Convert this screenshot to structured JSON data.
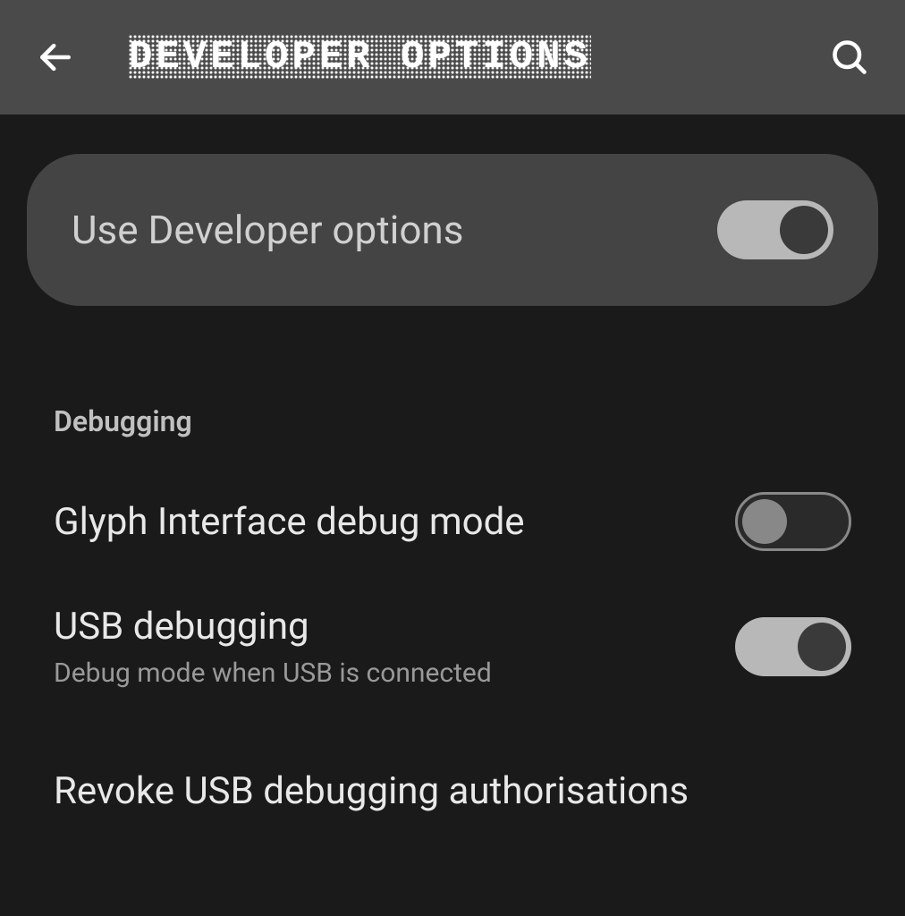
{
  "header": {
    "title": "DEVELOPER OPTIONS"
  },
  "main_toggle": {
    "label": "Use Developer options",
    "enabled": true
  },
  "section": {
    "title": "Debugging"
  },
  "settings": {
    "glyph_interface": {
      "title": "Glyph Interface debug mode",
      "enabled": false
    },
    "usb_debugging": {
      "title": "USB debugging",
      "subtitle": "Debug mode when USB is connected",
      "enabled": true
    },
    "revoke_usb": {
      "title": "Revoke USB debugging authorisations"
    }
  }
}
